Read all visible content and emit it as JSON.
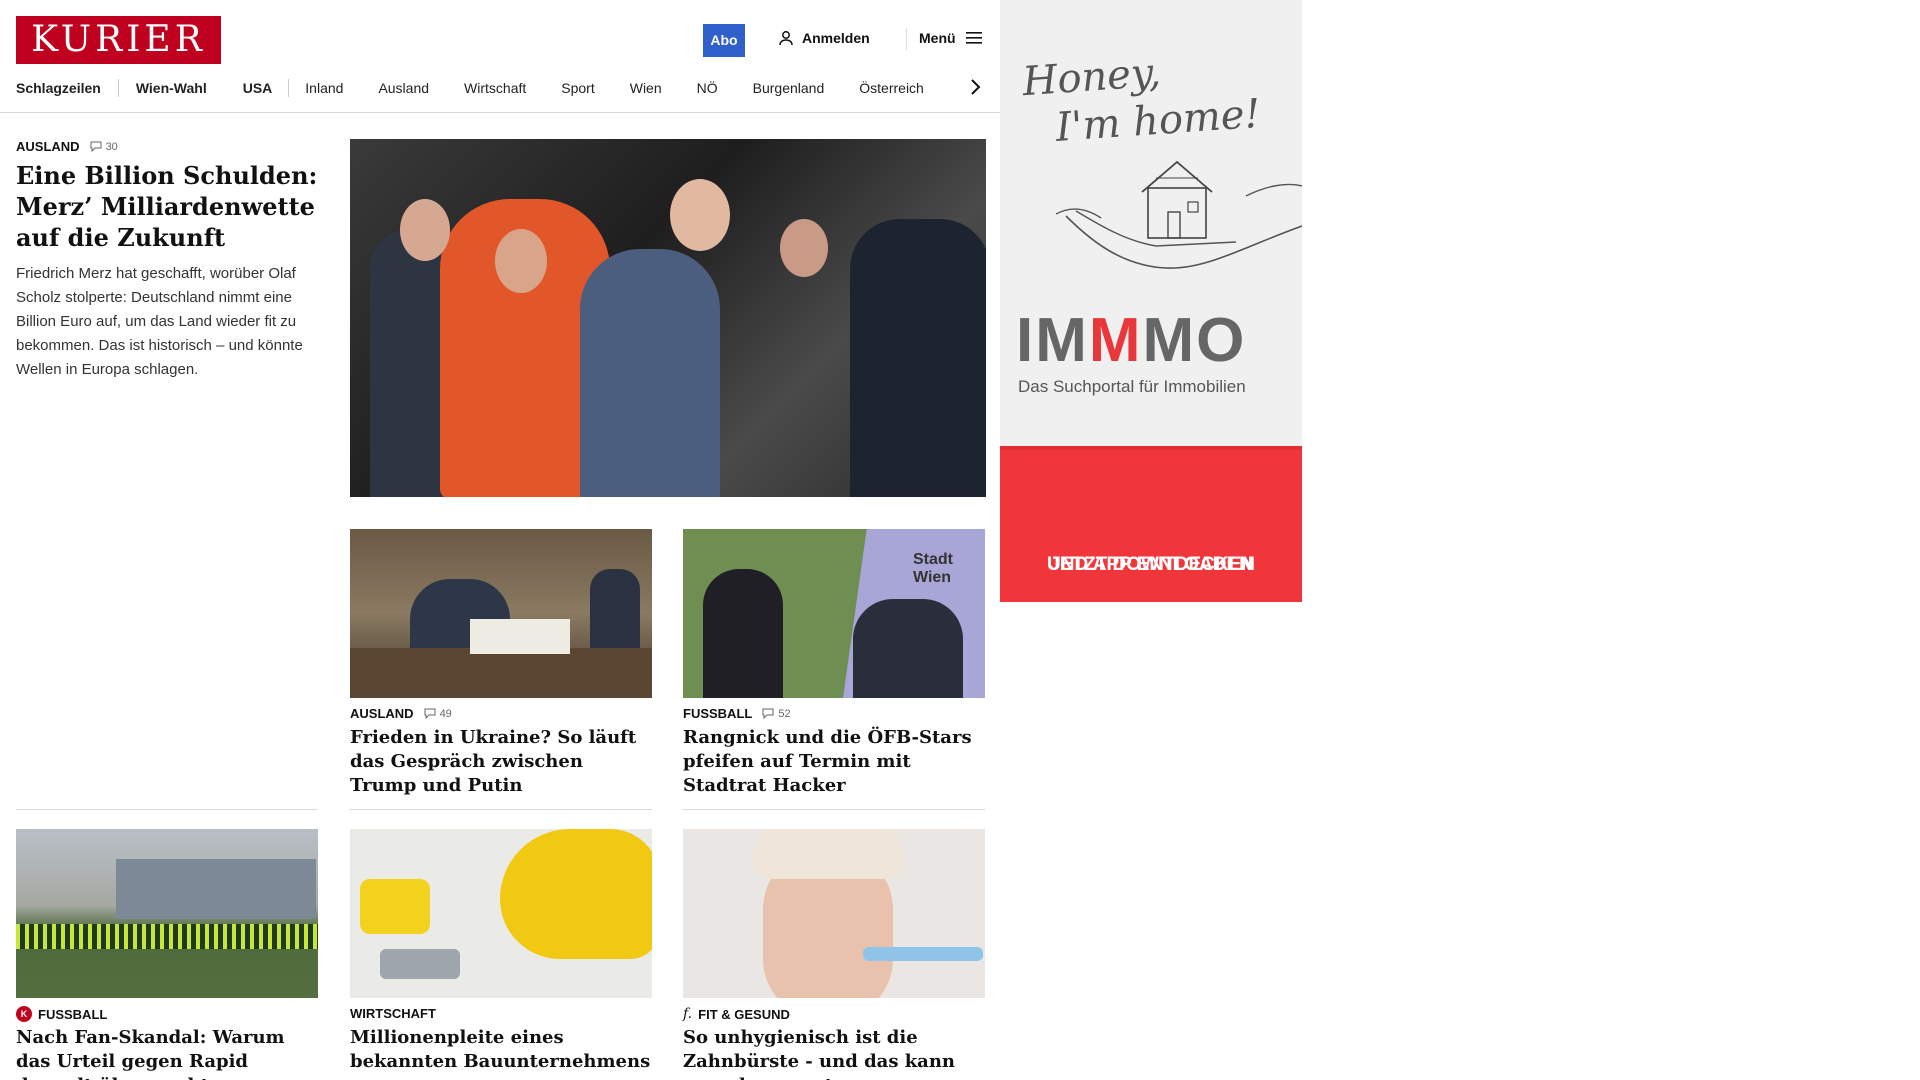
{
  "header": {
    "logo": "KURIER",
    "abo": "Abo",
    "login": "Anmelden",
    "menu": "Menü"
  },
  "nav": [
    "Schlagzeilen",
    "Wien-Wahl",
    "USA",
    "Inland",
    "Ausland",
    "Wirtschaft",
    "Sport",
    "Wien",
    "NÖ",
    "Burgenland",
    "Österreich"
  ],
  "lead": {
    "category": "AUSLAND",
    "comments": "30",
    "title": "Eine Billion Schulden: Merz’ Milliardenwette auf die Zukunft",
    "text": "Friedrich Merz hat geschafft, worüber Olaf Scholz stolperte: Deutschland nimmt eine Billion Euro auf, um das Land wieder fit zu bekommen. Das ist historisch – und könnte Wellen in Europa schlagen."
  },
  "cards": [
    {
      "category": "AUSLAND",
      "comments": "49",
      "title": "Frieden in Ukraine? So läuft das Gespräch zwischen Trump und Putin"
    },
    {
      "category": "FUSSBALL",
      "comments": "52",
      "title": "Rangnick und die ÖFB-Stars pfeifen auf Termin mit Stadtrat Hacker"
    },
    {
      "category": "FUSSBALL",
      "comments": "",
      "title": "Nach Fan-Skandal: Warum das Urteil gegen Rapid doppelt überrascht"
    },
    {
      "category": "WIRTSCHAFT",
      "comments": "",
      "title": "Millionenpleite eines bekannten Bauunternehmens"
    },
    {
      "category": "FIT & GESUND",
      "comments": "",
      "title": "So unhygienisch ist die Zahnbürste - und das kann man dagegen tun"
    }
  ],
  "ad": {
    "script_line1": "Honey,",
    "script_line2": "I'm home!",
    "brand_a": "IM",
    "brand_m": "M",
    "brand_b": "MO",
    "subtitle": "Das Suchportal für Immobilien",
    "cta_line1": "JETZT DOWNLOADEN",
    "cta_line2": "UND APP ENTDECKEN"
  },
  "image_text": {
    "stadt_wien_1": "Stadt",
    "stadt_wien_2": "Wien"
  },
  "colors": {
    "brand_red": "#c0001f",
    "abo_blue": "#2e5fcb",
    "ad_red": "#f0363a"
  }
}
